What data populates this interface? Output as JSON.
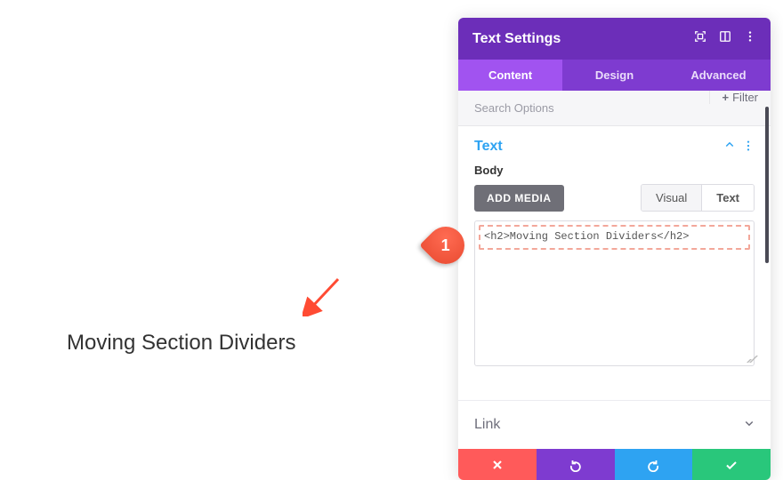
{
  "preview": {
    "heading": "Moving Section Dividers"
  },
  "annotation": {
    "number": "1"
  },
  "panel": {
    "title": "Text Settings",
    "tabs": {
      "content": "Content",
      "design": "Design",
      "advanced": "Advanced"
    },
    "search": {
      "placeholder": "Search Options",
      "filter_label": "Filter",
      "plus": "+"
    },
    "text_section": {
      "title": "Text",
      "body_label": "Body",
      "add_media": "ADD MEDIA"
    },
    "editor_tabs": {
      "visual": "Visual",
      "text": "Text"
    },
    "editor": {
      "value": "<h2>Moving Section Dividers</h2>"
    },
    "link_section": {
      "title": "Link"
    }
  }
}
